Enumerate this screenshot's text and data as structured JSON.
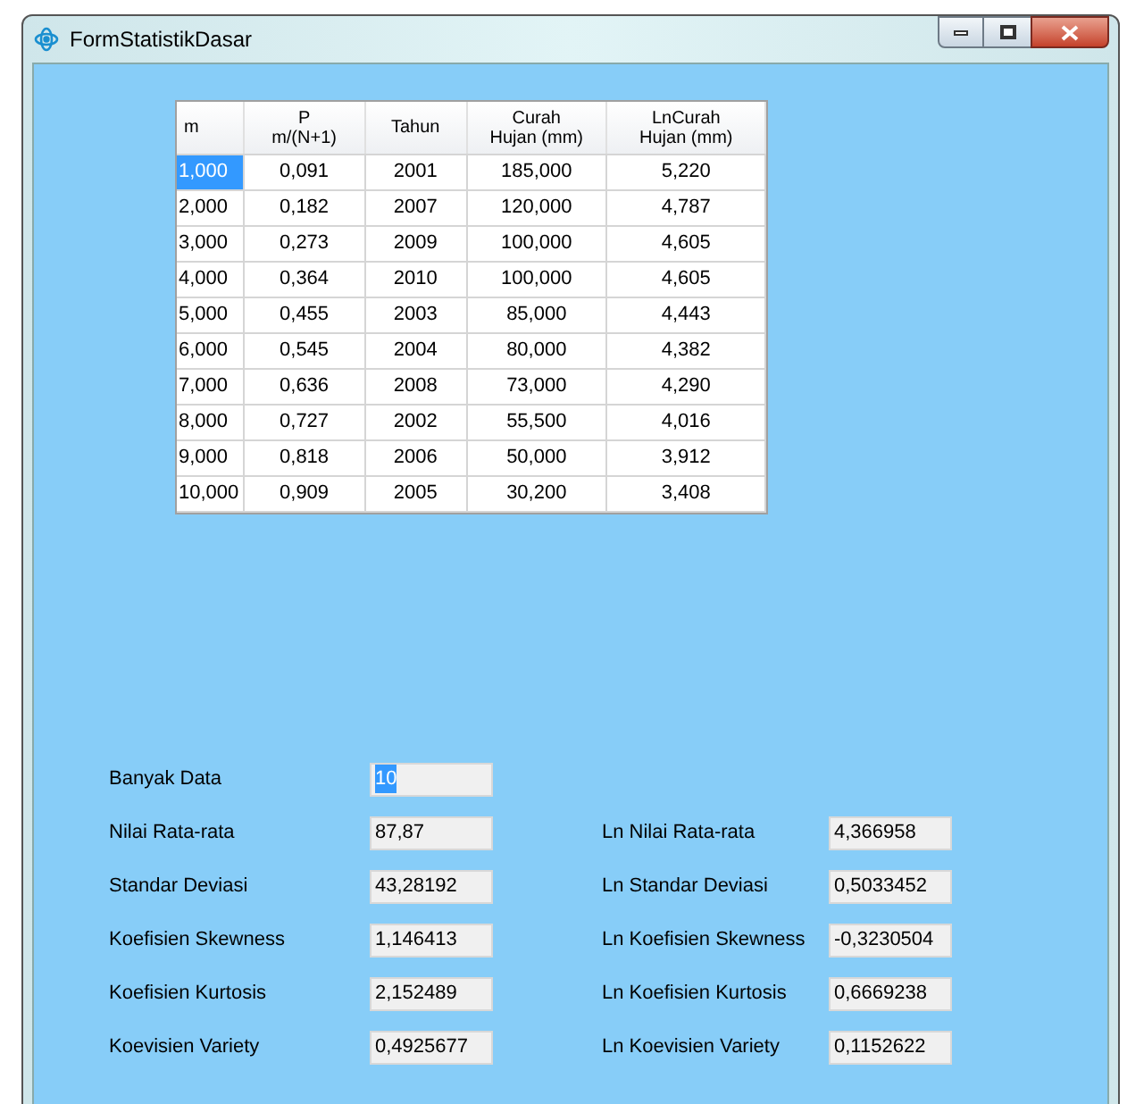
{
  "window": {
    "title": "FormStatistikDasar"
  },
  "table": {
    "columns": [
      "m",
      "P\nm/(N+1)",
      "Tahun",
      "Curah\nHujan (mm)",
      "LnCurah\nHujan (mm)"
    ],
    "rows": [
      {
        "selected": true,
        "cells": [
          "1,000",
          "0,091",
          "2001",
          "185,000",
          "5,220"
        ]
      },
      {
        "selected": false,
        "cells": [
          "2,000",
          "0,182",
          "2007",
          "120,000",
          "4,787"
        ]
      },
      {
        "selected": false,
        "cells": [
          "3,000",
          "0,273",
          "2009",
          "100,000",
          "4,605"
        ]
      },
      {
        "selected": false,
        "cells": [
          "4,000",
          "0,364",
          "2010",
          "100,000",
          "4,605"
        ]
      },
      {
        "selected": false,
        "cells": [
          "5,000",
          "0,455",
          "2003",
          "85,000",
          "4,443"
        ]
      },
      {
        "selected": false,
        "cells": [
          "6,000",
          "0,545",
          "2004",
          "80,000",
          "4,382"
        ]
      },
      {
        "selected": false,
        "cells": [
          "7,000",
          "0,636",
          "2008",
          "73,000",
          "4,290"
        ]
      },
      {
        "selected": false,
        "cells": [
          "8,000",
          "0,727",
          "2002",
          "55,500",
          "4,016"
        ]
      },
      {
        "selected": false,
        "cells": [
          "9,000",
          "0,818",
          "2006",
          "50,000",
          "3,912"
        ]
      },
      {
        "selected": false,
        "cells": [
          "10,000",
          "0,909",
          "2005",
          "30,200",
          "3,408"
        ]
      }
    ]
  },
  "count": {
    "label": "Banyak Data",
    "value": "10",
    "text_selected": true
  },
  "stats": [
    {
      "label": "Nilai Rata-rata",
      "value": "87,87",
      "ln_label": "Ln Nilai Rata-rata",
      "ln_value": "4,366958"
    },
    {
      "label": "Standar Deviasi",
      "value": "43,28192",
      "ln_label": "Ln Standar Deviasi",
      "ln_value": "0,5033452"
    },
    {
      "label": "Koefisien Skewness",
      "value": "1,146413",
      "ln_label": "Ln Koefisien Skewness",
      "ln_value": "-0,3230504"
    },
    {
      "label": "Koefisien Kurtosis",
      "value": "2,152489",
      "ln_label": "Ln Koefisien Kurtosis",
      "ln_value": "0,6669238"
    },
    {
      "label": "Koevisien Variety",
      "value": "0,4925677",
      "ln_label": "Ln Koevisien Variety",
      "ln_value": "0,1152622"
    }
  ]
}
